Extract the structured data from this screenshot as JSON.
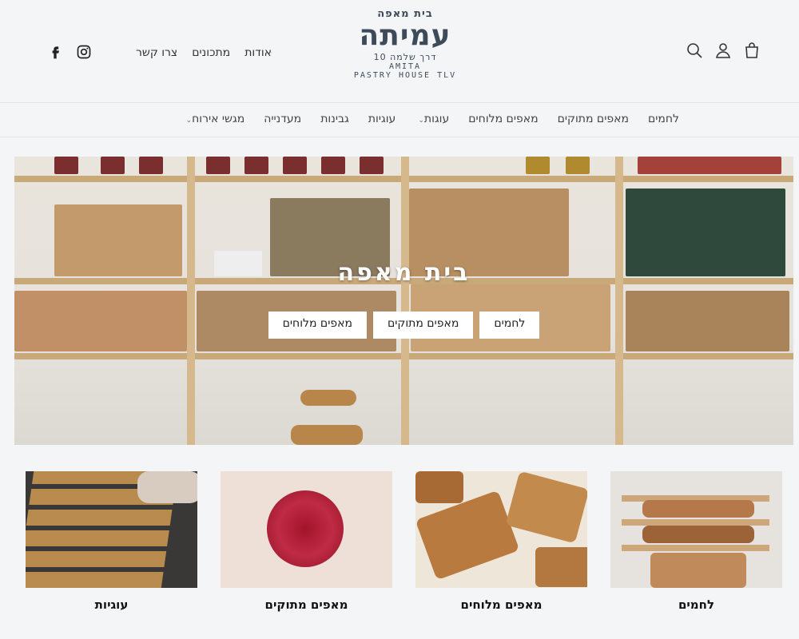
{
  "header": {
    "logo": {
      "top_text": "בית מאפה",
      "name": "עמיתה",
      "address": "דרך שלמה 10",
      "latin_name": "AMITA",
      "latin_sub": "PASTRY HOUSE TLV"
    },
    "links": [
      "אודות",
      "מתכונים",
      "צרו קשר"
    ],
    "icons": [
      "bag-icon",
      "account-icon",
      "search-icon",
      "facebook-icon",
      "instagram-icon"
    ]
  },
  "nav": {
    "items": [
      {
        "label": "לחמים",
        "has_dropdown": false
      },
      {
        "label": "מאפים מתוקים",
        "has_dropdown": false
      },
      {
        "label": "מאפים מלוחים",
        "has_dropdown": false
      },
      {
        "label": "עוגות",
        "has_dropdown": true
      },
      {
        "label": "עוגיות",
        "has_dropdown": false
      },
      {
        "label": "גבינות",
        "has_dropdown": false
      },
      {
        "label": "מעדנייה",
        "has_dropdown": false
      },
      {
        "label": "מגשי אירוח",
        "has_dropdown": true
      }
    ]
  },
  "hero": {
    "title": "בית מאפה",
    "buttons": [
      "לחמים",
      "מאפים מתוקים",
      "מאפים מלוחים"
    ]
  },
  "categories": [
    {
      "label": "לחמים"
    },
    {
      "label": "מאפים מלוחים"
    },
    {
      "label": "מאפים מתוקים"
    },
    {
      "label": "עוגיות"
    }
  ],
  "colors": {
    "page_bg": "#f4f5f6",
    "logo": "#3d4a5a",
    "shelf_wood": "#c9a97a"
  }
}
